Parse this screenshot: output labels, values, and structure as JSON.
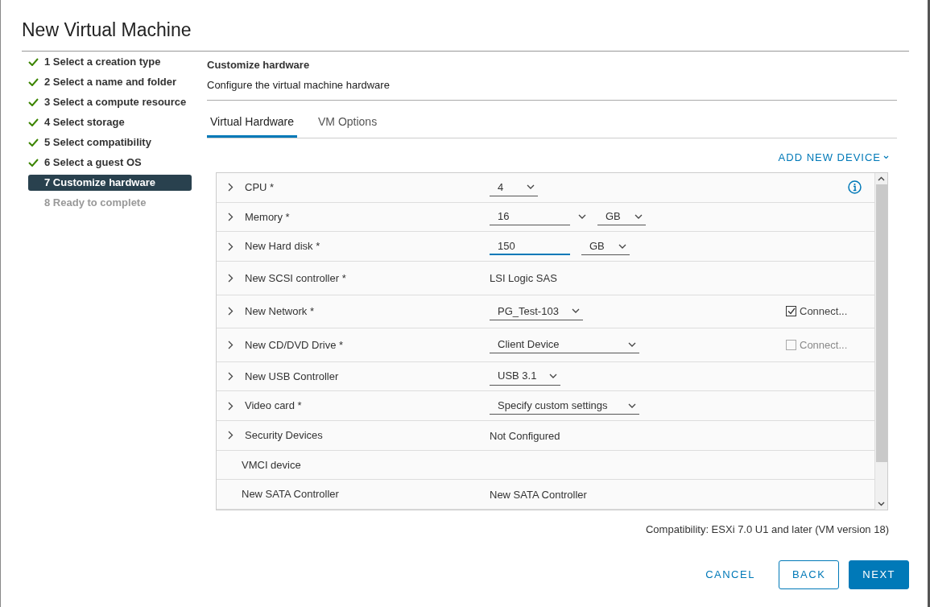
{
  "title": "New Virtual Machine",
  "steps": [
    {
      "label": "1 Select a creation type",
      "done": true,
      "selected": false,
      "disabled": false
    },
    {
      "label": "2 Select a name and folder",
      "done": true,
      "selected": false,
      "disabled": false
    },
    {
      "label": "3 Select a compute resource",
      "done": true,
      "selected": false,
      "disabled": false
    },
    {
      "label": "4 Select storage",
      "done": true,
      "selected": false,
      "disabled": false
    },
    {
      "label": "5 Select compatibility",
      "done": true,
      "selected": false,
      "disabled": false
    },
    {
      "label": "6 Select a guest OS",
      "done": true,
      "selected": false,
      "disabled": false
    },
    {
      "label": "7 Customize hardware",
      "done": false,
      "selected": true,
      "disabled": false
    },
    {
      "label": "8 Ready to complete",
      "done": false,
      "selected": false,
      "disabled": true
    }
  ],
  "heading": "Customize hardware",
  "subheading": "Configure the virtual machine hardware",
  "tabs": [
    {
      "label": "Virtual Hardware",
      "selected": true
    },
    {
      "label": "VM Options",
      "selected": false
    }
  ],
  "add_device": "ADD NEW DEVICE",
  "rows": [
    {
      "label": "CPU *",
      "expandable": true,
      "kind": "select",
      "value": "4",
      "info": true
    },
    {
      "label": "Memory *",
      "expandable": true,
      "kind": "number_unit",
      "value": "16",
      "combo": true,
      "focused": false,
      "unit": "GB"
    },
    {
      "label": "New Hard disk *",
      "expandable": true,
      "kind": "number_unit",
      "value": "150",
      "combo": false,
      "focused": true,
      "unit": "GB"
    },
    {
      "label": "New SCSI controller *",
      "expandable": true,
      "kind": "text",
      "value": "LSI Logic SAS"
    },
    {
      "label": "New Network *",
      "expandable": true,
      "kind": "select",
      "value": "PG_Test-103",
      "connect": {
        "label": "Connect...",
        "checked": true,
        "disabled": false
      }
    },
    {
      "label": "New CD/DVD Drive *",
      "expandable": true,
      "kind": "select",
      "value": "Client Device",
      "connect": {
        "label": "Connect...",
        "checked": false,
        "disabled": true
      }
    },
    {
      "label": "New USB Controller",
      "expandable": true,
      "kind": "select",
      "value": "USB 3.1"
    },
    {
      "label": "Video card *",
      "expandable": true,
      "kind": "select",
      "value": "Specify custom settings"
    },
    {
      "label": "Security Devices",
      "expandable": true,
      "kind": "text",
      "value": "Not Configured"
    },
    {
      "label": "VMCI device",
      "expandable": false,
      "kind": "none"
    },
    {
      "label": "New SATA Controller",
      "expandable": false,
      "kind": "text",
      "value": "New SATA Controller"
    }
  ],
  "compatibility": "Compatibility: ESXi 7.0 U1 and later (VM version 18)",
  "buttons": [
    {
      "label": "CANCEL",
      "kind": "flat"
    },
    {
      "label": "BACK",
      "kind": "outline"
    },
    {
      "label": "NEXT",
      "kind": "primary"
    }
  ]
}
